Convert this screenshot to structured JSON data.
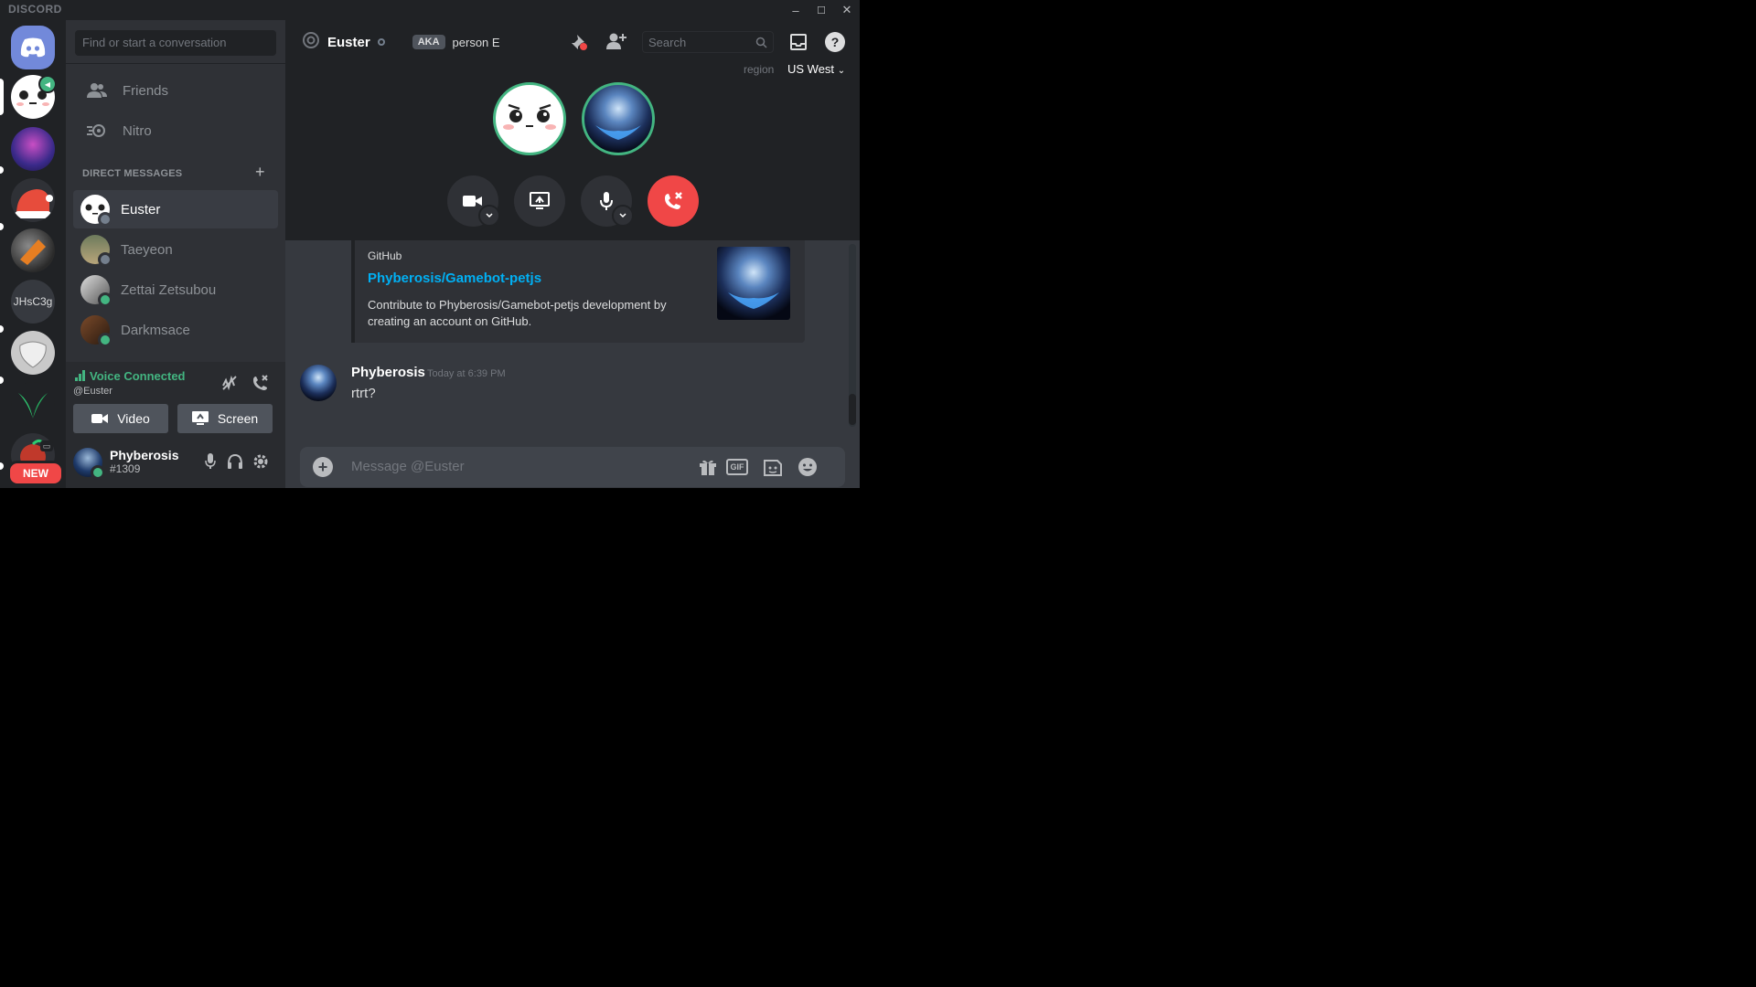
{
  "app": {
    "brand": "DISCORD",
    "window_controls": [
      "–",
      "☐",
      "✕"
    ]
  },
  "guilds": [
    {
      "name": "home",
      "label": ""
    },
    {
      "name": "emoji-server",
      "label": ""
    },
    {
      "name": "art-server",
      "label": ""
    },
    {
      "name": "santa-server",
      "label": ""
    },
    {
      "name": "game-server",
      "label": ""
    },
    {
      "name": "jhsc3g",
      "label": "JHsC3g"
    },
    {
      "name": "sketch-server",
      "label": ""
    },
    {
      "name": "leaf-server",
      "label": ""
    },
    {
      "name": "new-server",
      "label": "NEW"
    }
  ],
  "sidebar": {
    "search_placeholder": "Find or start a conversation",
    "nav": [
      {
        "label": "Friends",
        "icon": "friends-icon"
      },
      {
        "label": "Nitro",
        "icon": "nitro-icon"
      }
    ],
    "dm_header": "DIRECT MESSAGES",
    "dm_add": "+",
    "dms": [
      {
        "name": "Euster",
        "status": "offline",
        "status_color": "#747f8d"
      },
      {
        "name": "Taeyeon",
        "status": "offline",
        "status_color": "#747f8d"
      },
      {
        "name": "Zettai Zetsubou",
        "status": "online",
        "status_color": "#43b581"
      },
      {
        "name": "Darkmsace",
        "status": "online",
        "status_color": "#43b581"
      }
    ]
  },
  "voice": {
    "status": "Voice Connected",
    "channel": "@Euster",
    "video_label": "Video",
    "screen_label": "Screen"
  },
  "user": {
    "name": "Phyberosis",
    "discriminator": "#1309"
  },
  "header": {
    "name": "Euster",
    "aka": "AKA",
    "aka_name": "person E",
    "search_placeholder": "Search",
    "region_label": "region",
    "region_value": "US West"
  },
  "embed": {
    "provider": "GitHub",
    "title": "Phyberosis/Gamebot-petjs",
    "description": "Contribute to Phyberosis/Gamebot-petjs development by creating an account on GitHub."
  },
  "message": {
    "author": "Phyberosis",
    "timestamp": "Today at 6:39 PM",
    "text": "rtrt?"
  },
  "composer": {
    "placeholder": "Message @Euster",
    "gif_label": "GIF"
  },
  "colors": {
    "accent": "#7289da",
    "online": "#43b581",
    "danger": "#f04747",
    "link": "#00b0f4"
  }
}
